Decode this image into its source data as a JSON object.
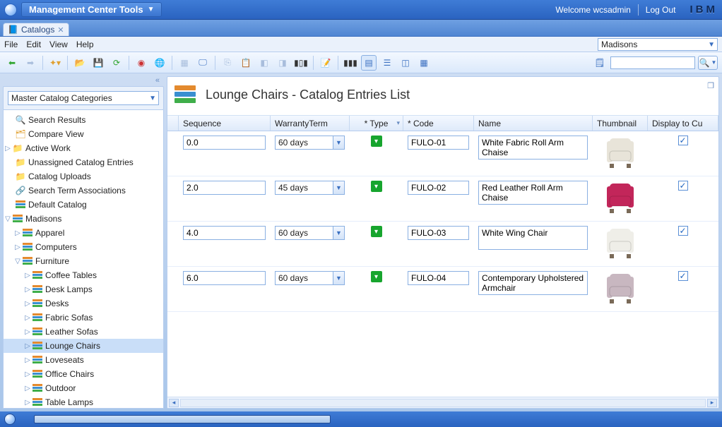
{
  "titlebar": {
    "tools_label": "Management Center Tools",
    "welcome": "Welcome wcsadmin",
    "logout": "Log Out",
    "brand": "IBM"
  },
  "app_tab": {
    "label": "Catalogs"
  },
  "menus": {
    "file": "File",
    "edit": "Edit",
    "view": "View",
    "help": "Help"
  },
  "store_selector": "Madisons",
  "sidebar": {
    "combo": "Master Catalog Categories",
    "nodes": {
      "search_results": "Search Results",
      "compare_view": "Compare View",
      "active_work": "Active Work",
      "unassigned": "Unassigned Catalog Entries",
      "catalog_uploads": "Catalog Uploads",
      "search_term_assoc": "Search Term Associations",
      "default_catalog": "Default Catalog",
      "madisons": "Madisons",
      "apparel": "Apparel",
      "computers": "Computers",
      "furniture": "Furniture",
      "coffee_tables": "Coffee Tables",
      "desk_lamps": "Desk Lamps",
      "desks": "Desks",
      "fabric_sofas": "Fabric Sofas",
      "leather_sofas": "Leather Sofas",
      "lounge_chairs": "Lounge Chairs",
      "loveseats": "Loveseats",
      "office_chairs": "Office Chairs",
      "outdoor": "Outdoor",
      "table_lamps": "Table Lamps"
    }
  },
  "content": {
    "title": "Lounge Chairs - Catalog Entries List",
    "columns": {
      "sequence": "Sequence",
      "warranty": "WarrantyTerm",
      "type": "* Type",
      "code": "* Code",
      "name": "Name",
      "thumbnail": "Thumbnail",
      "display": "Display to Cu"
    },
    "rows": [
      {
        "sequence": "0.0",
        "warranty": "60 days",
        "code": "FULO-01",
        "name": "White Fabric Roll Arm Chaise",
        "thumb_color": "#e8e4d9",
        "display": true
      },
      {
        "sequence": "2.0",
        "warranty": "45 days",
        "code": "FULO-02",
        "name": "Red Leather Roll Arm Chaise",
        "thumb_color": "#c2265a",
        "display": true
      },
      {
        "sequence": "4.0",
        "warranty": "60 days",
        "code": "FULO-03",
        "name": "White Wing Chair",
        "thumb_color": "#efeee8",
        "display": true
      },
      {
        "sequence": "6.0",
        "warranty": "60 days",
        "code": "FULO-04",
        "name": "Contemporary Upholstered Armchair",
        "thumb_color": "#c8b7c0",
        "display": true
      }
    ]
  }
}
